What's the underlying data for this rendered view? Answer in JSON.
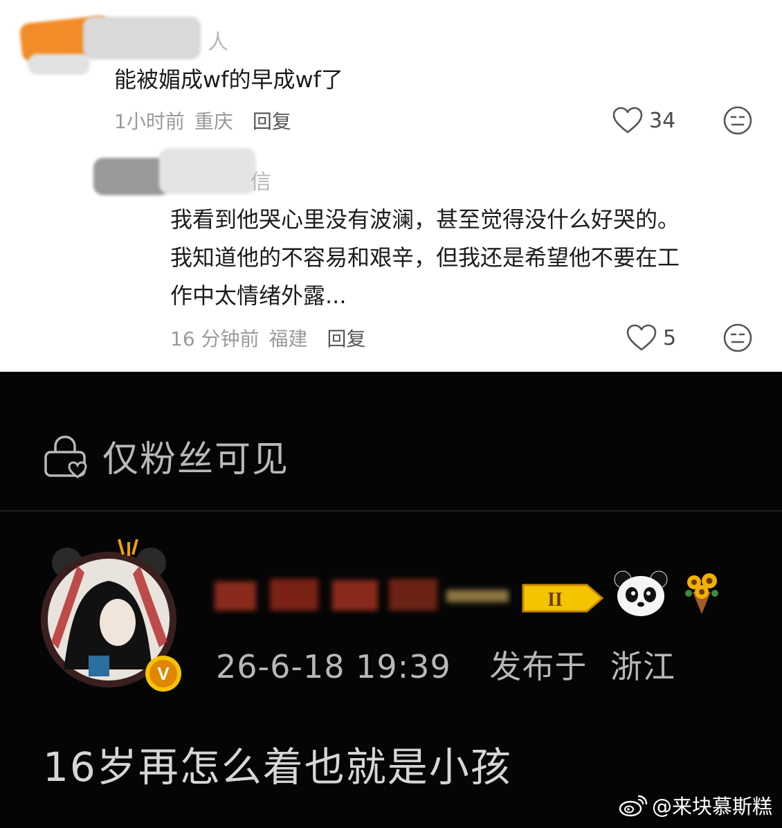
{
  "comments": [
    {
      "username_visible_tail": "人",
      "text_lines": [
        "能被媚成wf的早成wf了"
      ],
      "time": "1小时前",
      "location": "重庆",
      "reply_label": "回复",
      "likes": "34"
    },
    {
      "username_visible_tail": "信",
      "text_lines": [
        "我看到他哭心里没有波澜，甚至觉得没什么好哭的。",
        "我知道他的不容易和艰辛，但我还是希望他不要在工",
        "作中太情绪外露..."
      ],
      "time": "16 分钟前",
      "location": "福建",
      "reply_label": "回复",
      "likes": "5"
    }
  ],
  "post": {
    "visibility_label": "仅粉丝可见",
    "level_badge": "II",
    "timestamp": "26-6-18 19:39",
    "location_prefix": "发布于",
    "location": "浙江",
    "verified_mark": "V",
    "text": "16岁再怎么着也就是小孩"
  },
  "watermark": {
    "text": "@来块慕斯糕"
  },
  "icons": {
    "like": "heart-outline-icon",
    "emoji": "neutral-face-icon",
    "lock": "lock-heart-icon",
    "platform": "weibo-logo-icon"
  },
  "colors": {
    "accent_orange": "#f28c28",
    "badge_gold": "#f5c400",
    "dark_bg": "#050505"
  }
}
